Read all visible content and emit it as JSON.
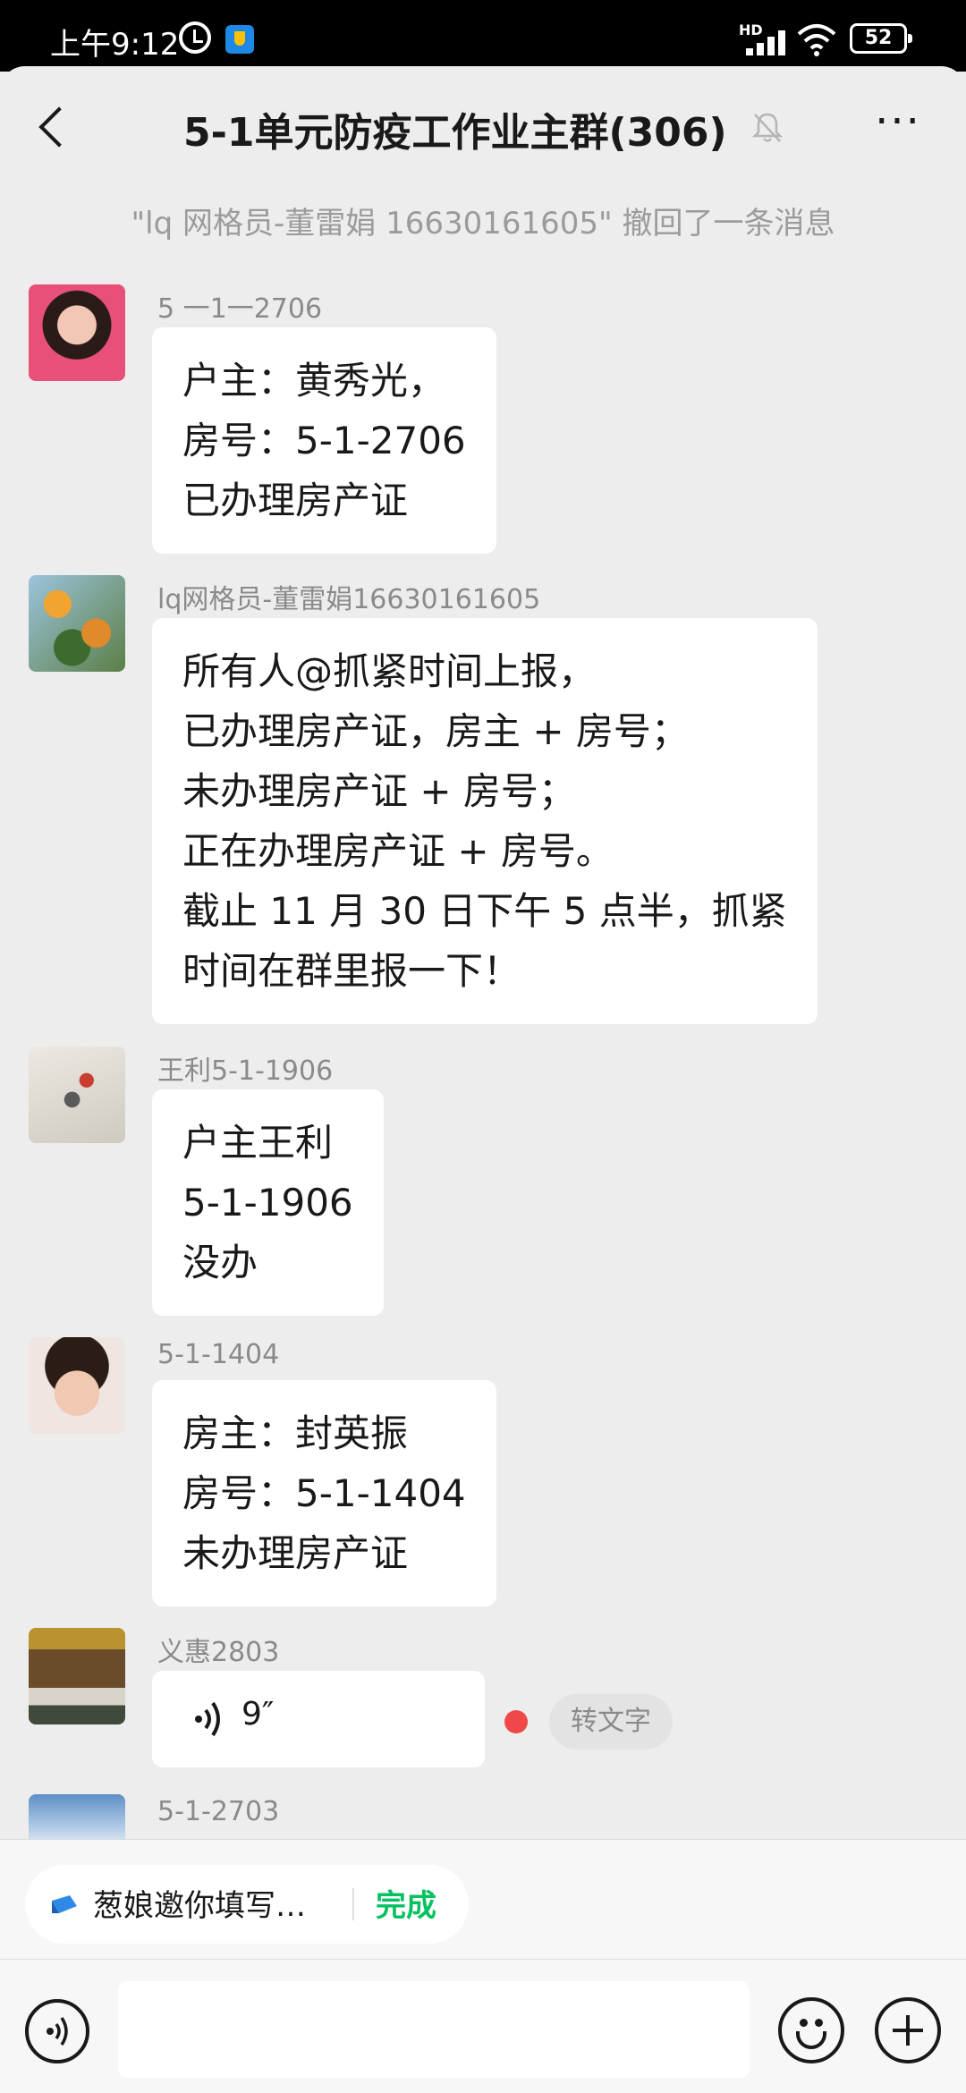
{
  "status_bar": {
    "time": "上午9:12",
    "network": "HD",
    "battery": "52"
  },
  "header": {
    "title": "5-1单元防疫工作业主群(306)",
    "more": "···"
  },
  "system_notice": "\"lq 网格员-董雷娟 16630161605\" 撤回了一条消息",
  "messages": [
    {
      "sender": "5 一1一2706",
      "lines": [
        "户主：黄秀光，",
        "房号：5-1-2706",
        "已办理房产证"
      ]
    },
    {
      "sender": "lq网格员-董雷娟16630161605",
      "lines": [
        "所有人@抓紧时间上报，",
        "已办理房产证，房主 + 房号；",
        "未办理房产证 + 房号；",
        "正在办理房产证 + 房号。",
        "截止 11 月 30 日下午 5 点半，抓紧",
        "时间在群里报一下！"
      ]
    },
    {
      "sender": "王利5-1-1906",
      "lines": [
        "户主王利",
        "5-1-1906",
        "没办"
      ]
    },
    {
      "sender": "5-1-1404",
      "lines": [
        "房主：封英振",
        "房号：5-1-1404",
        "未办理房产证"
      ]
    },
    {
      "sender": "义惠2803",
      "voice_duration": "9″",
      "to_text": "转文字"
    },
    {
      "sender": "5-1-2703"
    }
  ],
  "task_bar": {
    "text": "葱娘邀你填写…",
    "done": "完成"
  },
  "colors": {
    "background": "#ededed",
    "bubble": "#ffffff",
    "accent_green": "#07c160",
    "unread_dot": "#f04848"
  }
}
